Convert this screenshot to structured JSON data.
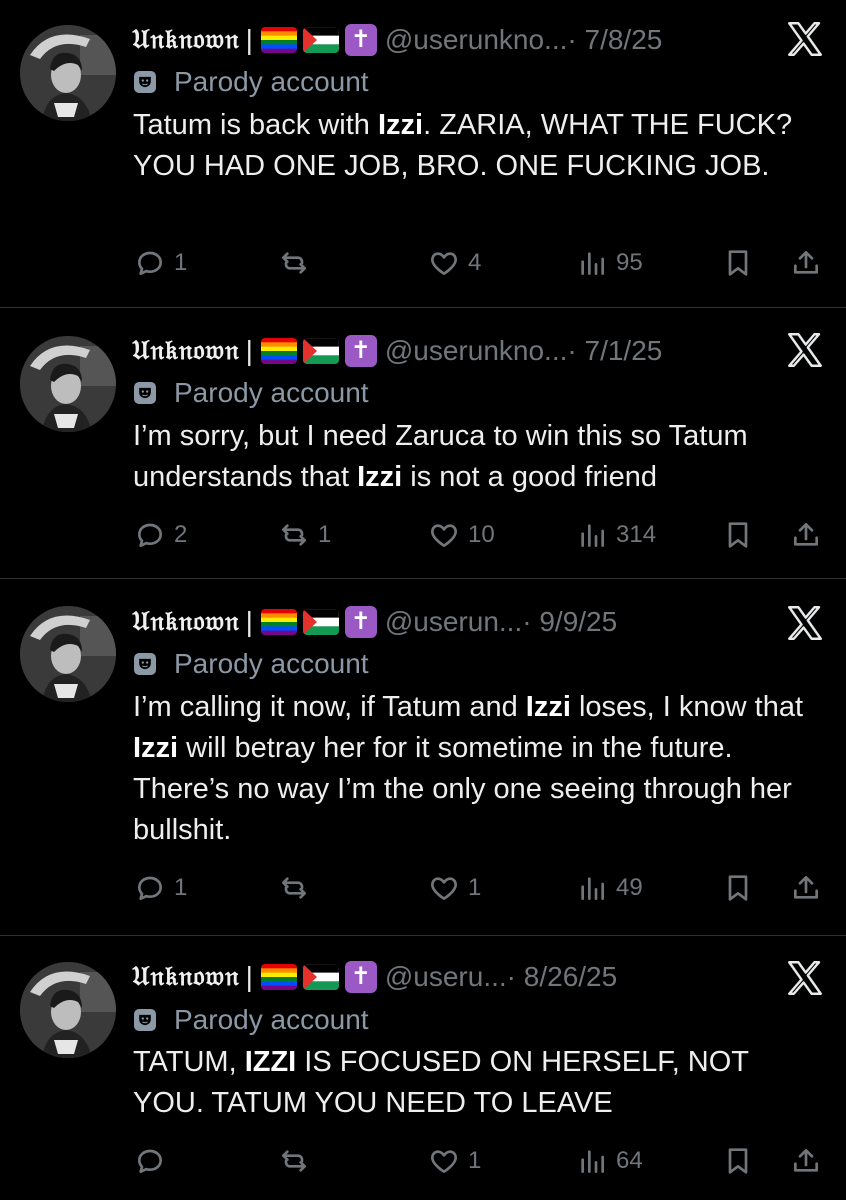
{
  "tweets": [
    {
      "name": "𝔘𝔫𝔨𝔫𝔬𝔴𝔫",
      "separator": "|",
      "handle": "@userunkno...",
      "date": "· 7/8/25",
      "parody_label": "Parody account",
      "body_parts": [
        "Tatum is back with ",
        "Izzi",
        ". ZARIA, WHAT THE FUCK? YOU HAD ONE JOB, BRO. ONE FUCKING JOB."
      ],
      "replies": "1",
      "reposts": "",
      "likes": "4",
      "views": "95"
    },
    {
      "name": "𝔘𝔫𝔨𝔫𝔬𝔴𝔫",
      "separator": "|",
      "handle": "@userunkno...",
      "date": "· 7/1/25",
      "parody_label": "Parody account",
      "body_parts": [
        "I’m sorry, but I need Zaruca to win this so Tatum understands that ",
        "Izzi",
        " is not a good friend"
      ],
      "replies": "2",
      "reposts": "1",
      "likes": "10",
      "views": "314"
    },
    {
      "name": "𝔘𝔫𝔨𝔫𝔬𝔴𝔫",
      "separator": "|",
      "handle": "@userun...",
      "date": "· 9/9/25",
      "parody_label": "Parody account",
      "body_parts": [
        "I’m calling it now, if Tatum and ",
        "Izzi",
        " loses, I know that ",
        "Izzi",
        " will betray her for it sometime in the future. There’s no way I’m the only one seeing through her bullshit."
      ],
      "replies": "1",
      "reposts": "",
      "likes": "1",
      "views": "49"
    },
    {
      "name": "𝔘𝔫𝔨𝔫𝔬𝔴𝔫",
      "separator": "|",
      "handle": "@useru...",
      "date": "· 8/26/25",
      "parody_label": "Parody account",
      "body_parts": [
        "TATUM, ",
        "IZZI",
        " IS FOCUSED ON HERSELF, NOT YOU. TATUM YOU NEED TO LEAVE"
      ],
      "replies": "",
      "reposts": "",
      "likes": "1",
      "views": "64"
    }
  ],
  "icons": {
    "flags": [
      "rainbow-flag-icon",
      "palestine-flag-icon"
    ],
    "cross": "latin-cross-icon",
    "cross_glyph": "✝",
    "parody": "performing-arts-mask-icon",
    "brand": "x-logo-icon",
    "actions": [
      "reply-icon",
      "repost-icon",
      "like-icon",
      "views-icon",
      "bookmark-icon",
      "share-icon"
    ]
  },
  "colors": {
    "background": "#000000",
    "text": "#e7e9ea",
    "muted": "#71767b",
    "cross_badge": "#9b59c5",
    "divider": "#2f3336"
  }
}
